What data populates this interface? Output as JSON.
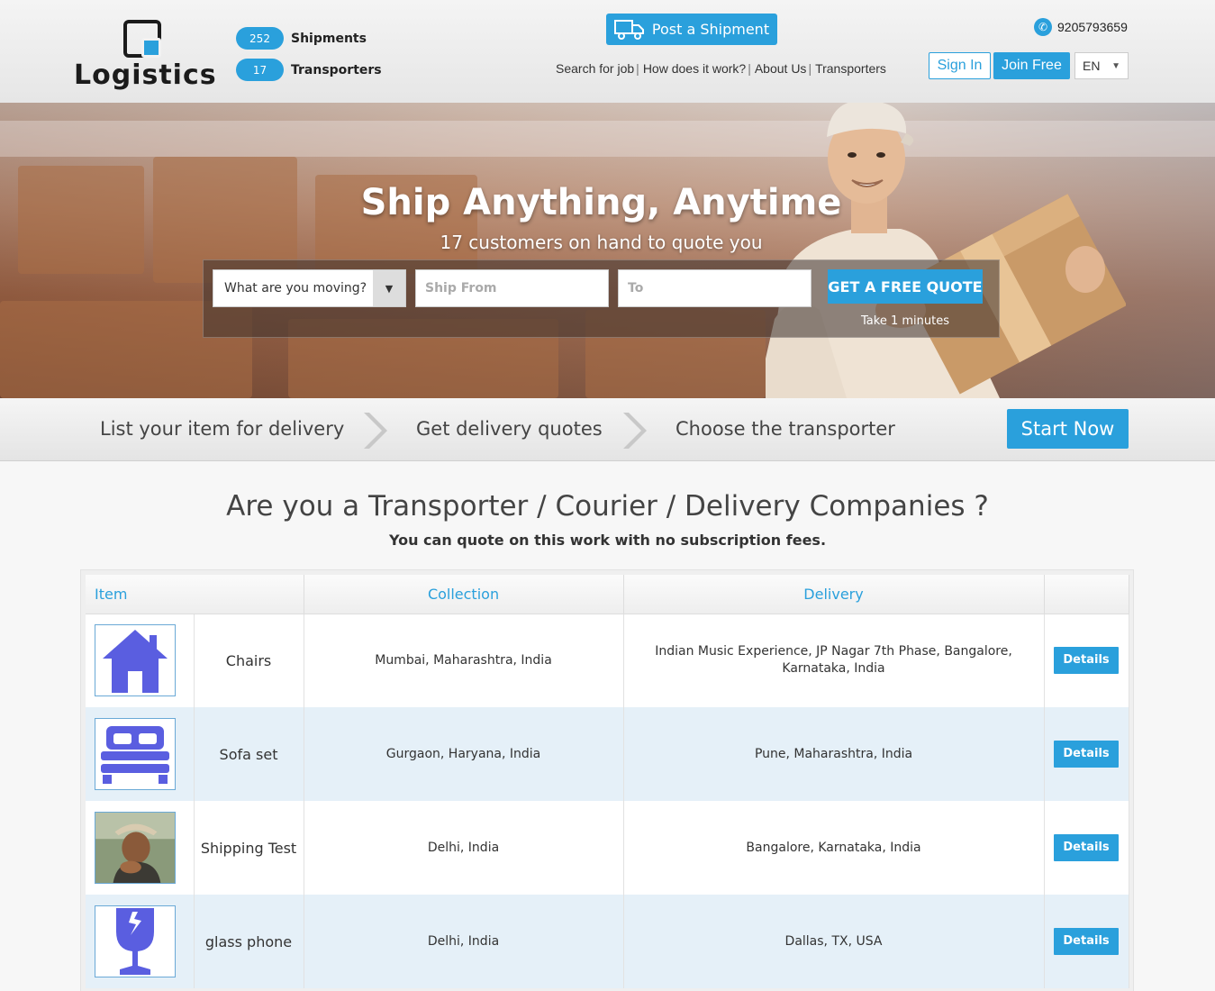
{
  "header": {
    "logo_text": "Logistics",
    "stats": [
      {
        "count": "252",
        "label": "Shipments"
      },
      {
        "count": "17",
        "label": "Transporters"
      }
    ],
    "post_shipment_label": "Post a Shipment",
    "nav": [
      {
        "label": "Search for job"
      },
      {
        "label": "How does it work?"
      },
      {
        "label": "About Us"
      },
      {
        "label": "Transporters"
      }
    ],
    "phone": "9205793659",
    "sign_in_label": "Sign In",
    "join_free_label": "Join Free",
    "language": "EN"
  },
  "hero": {
    "title": "Ship Anything, Anytime",
    "subtitle": "17 customers on hand to quote you",
    "item_select": "What are you moving?",
    "ship_from_placeholder": "Ship From",
    "to_placeholder": "To",
    "quote_button": "GET A FREE QUOTE",
    "quote_note": "Take 1 minutes"
  },
  "steps": {
    "items": [
      "List your item for delivery",
      "Get delivery quotes",
      "Choose the transporter"
    ],
    "start_label": "Start Now"
  },
  "transporter_section": {
    "title": "Are you a Transporter / Courier / Delivery Companies ?",
    "subtitle": "You can quote on this work with no subscription fees.",
    "columns": [
      "Item",
      "Collection",
      "Delivery"
    ],
    "details_label": "Details",
    "rows": [
      {
        "icon": "house-icon",
        "item": "Chairs",
        "collection": "Mumbai, Maharashtra, India",
        "delivery": "Indian Music Experience, JP Nagar 7th Phase, Bangalore, Karnataka, India"
      },
      {
        "icon": "bed-icon",
        "item": "Sofa set",
        "collection": "Gurgaon, Haryana, India",
        "delivery": "Pune, Maharashtra, India"
      },
      {
        "icon": "person-photo",
        "item": "Shipping Test",
        "collection": "Delhi, India",
        "delivery": "Bangalore, Karnataka, India"
      },
      {
        "icon": "fragile-glass-icon",
        "item": "glass phone",
        "collection": "Delhi, India",
        "delivery": "Dallas, TX, USA"
      }
    ]
  },
  "colors": {
    "accent": "#2aa0dc",
    "icon_purple": "#5a5ee0",
    "row_alt": "#e5f0f8"
  }
}
